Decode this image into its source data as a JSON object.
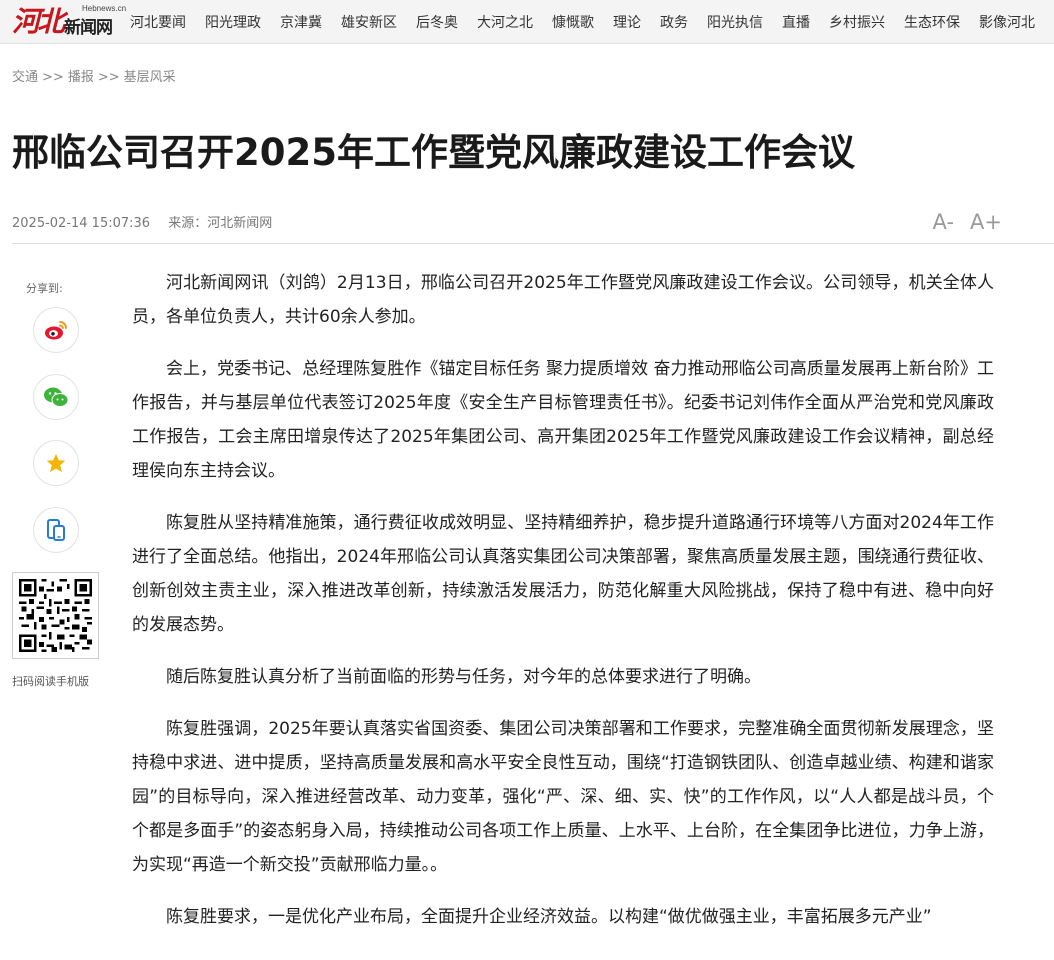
{
  "logo": {
    "main": "河北",
    "sub": "新闻网",
    "small": "Hebnews.cn"
  },
  "nav": [
    "河北要闻",
    "阳光理政",
    "京津冀",
    "雄安新区",
    "后冬奥",
    "大河之北",
    "慷慨歌",
    "理论",
    "政务",
    "阳光执信",
    "直播",
    "乡村振兴",
    "生态环保",
    "影像河北"
  ],
  "breadcrumb": {
    "items": [
      "交通",
      "播报",
      "基层风采"
    ],
    "sep": ">>"
  },
  "article": {
    "title": "邢临公司召开2025年工作暨党风廉政建设工作会议",
    "datetime": "2025-02-14 15:07:36",
    "source": "来源：河北新闻网",
    "font_decrease": "A-",
    "font_increase": "A+",
    "paragraphs": [
      "河北新闻网讯（刘鸽）2月13日，邢临公司召开2025年工作暨党风廉政建设工作会议。公司领导，机关全体人员，各单位负责人，共计60余人参加。",
      "会上，党委书记、总经理陈复胜作《锚定目标任务 聚力提质增效 奋力推动邢临公司高质量发展再上新台阶》工作报告，并与基层单位代表签订2025年度《安全生产目标管理责任书》。纪委书记刘伟作全面从严治党和党风廉政工作报告，工会主席田增泉传达了2025年集团公司、高开集团2025年工作暨党风廉政建设工作会议精神，副总经理侯向东主持会议。",
      "陈复胜从坚持精准施策，通行费征收成效明显、坚持精细养护，稳步提升道路通行环境等八方面对2024年工作进行了全面总结。他指出，2024年邢临公司认真落实集团公司决策部署，聚焦高质量发展主题，围绕通行费征收、创新创效主责主业，深入推进改革创新，持续激活发展活力，防范化解重大风险挑战，保持了稳中有进、稳中向好的发展态势。",
      "随后陈复胜认真分析了当前面临的形势与任务，对今年的总体要求进行了明确。",
      "陈复胜强调，2025年要认真落实省国资委、集团公司决策部署和工作要求，完整准确全面贯彻新发展理念，坚持稳中求进、进中提质，坚持高质量发展和高水平安全良性互动，围绕“打造钢铁团队、创造卓越业绩、构建和谐家园”的目标导向，深入推进经营改革、动力变革，强化“严、深、细、实、快”的工作作风，以“人人都是战斗员，个个都是多面手”的姿态躬身入局，持续推动公司各项工作上质量、上水平、上台阶，在全集团争比进位，力争上游，为实现“再造一个新交投”贡献邢临力量。。",
      "陈复胜要求，一是优化产业布局，全面提升企业经济效益。以构建“做优做强主业，丰富拓展多元产业”"
    ]
  },
  "share": {
    "label": "分享到:",
    "items": [
      "weibo-icon",
      "wechat-icon",
      "favorite-icon",
      "mobile-icon"
    ]
  },
  "qr": {
    "caption": "扫码阅读手机版"
  },
  "colors": {
    "brand": "#c8161d",
    "weibo": "#e6162d",
    "wechat": "#3db33b",
    "star": "#f4b400",
    "mobile": "#2a7bd4"
  }
}
